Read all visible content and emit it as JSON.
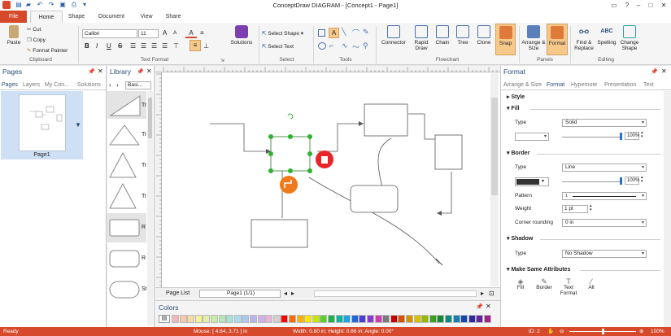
{
  "window": {
    "title": "ConceptDraw DIAGRAM - [Concept1 - Page1]"
  },
  "tabs": {
    "file": "File",
    "items": [
      "Home",
      "Shape",
      "Document",
      "View",
      "Share"
    ]
  },
  "clipboard": {
    "paste": "Paste",
    "cut": "Cut",
    "copy": "Copy",
    "format_painter": "Format Painter",
    "group": "Clipboard"
  },
  "text_format": {
    "font": "Calibri",
    "size": "11",
    "group": "Text Format",
    "bold": "B",
    "italic": "I",
    "underline": "U",
    "strike": "S",
    "grow": "A",
    "shrink": "A"
  },
  "solutions": {
    "label": "Solutions"
  },
  "select": {
    "select_shape": "Select Shape",
    "select_text": "Select Text",
    "group": "Select"
  },
  "tools": {
    "group": "Tools"
  },
  "flowchart": {
    "connector": "Connector",
    "rapid_draw": "Rapid Draw",
    "chain": "Chain",
    "tree": "Tree",
    "clone": "Clone",
    "snap": "Snap",
    "group": "Flowchart"
  },
  "panels": {
    "arrange": "Arrange & Size",
    "format": "Format",
    "group": "Panels"
  },
  "editing": {
    "find": "Find & Replace",
    "spelling": "Spelling",
    "change_shape": "Change Shape",
    "group": "Editing"
  },
  "pages_panel": {
    "title": "Pages",
    "tabs": [
      "Pages",
      "Layers",
      "My Con...",
      "Solutions"
    ],
    "page_label": "Page1"
  },
  "library": {
    "title": "Library",
    "combo": "Basi...",
    "items": [
      "Tr",
      "Tr",
      "Tr",
      "Tr",
      "R",
      "R",
      "St"
    ]
  },
  "canvas": {
    "page_list": "Page List",
    "page_combo": "Page1 (1/1)"
  },
  "colors_panel": {
    "title": "Colors",
    "swatches": [
      "#f3b8b8",
      "#f6c7a8",
      "#f6dca0",
      "#f6ef9c",
      "#e2f0a0",
      "#c9eba4",
      "#b2e6b6",
      "#a6e2d6",
      "#a8dcef",
      "#a8c8f0",
      "#b6b6ef",
      "#cfb0ec",
      "#eeb0dc",
      "#d0d0d0",
      "#ff0000",
      "#ff6a00",
      "#ffb000",
      "#ffe600",
      "#c8e600",
      "#5ccf2a",
      "#1fb24a",
      "#12b2a0",
      "#1da6e0",
      "#2266d8",
      "#4a3fd0",
      "#8a3bd0",
      "#d03bb4",
      "#7a7a7a",
      "#c40000",
      "#d85000",
      "#d89000",
      "#d8c200",
      "#96b800",
      "#3aa01a",
      "#0f8a36",
      "#0a8a7c",
      "#1080b0",
      "#1446a8",
      "#302aa0",
      "#6424a0",
      "#a02486"
    ]
  },
  "format_panel": {
    "title": "Format",
    "tabs": [
      "Arrange & Size",
      "Format",
      "Hypernote",
      "Presentation",
      "Text"
    ],
    "style": "Style",
    "fill": "Fill",
    "type_label": "Type",
    "fill_type": "Solid",
    "fill_pct": "100%",
    "border": "Border",
    "border_type": "Line",
    "border_pct": "100%",
    "pattern_label": "Pattern",
    "pattern_val": "1",
    "weight_label": "Weight",
    "weight": "1 pt",
    "corner_label": "Corner rounding",
    "corner": "0 in",
    "shadow": "Shadow",
    "shadow_type": "No Shadow",
    "make_same": "Make Same Attributes",
    "same_items": [
      "Fill",
      "Border",
      "Text Format",
      "All"
    ]
  },
  "status": {
    "ready": "Ready",
    "mouse": "Mouse: [ 4.64, 3.71 ] in",
    "size": "Width: 0.80 in; Height: 0.66 in; Angle: 0.00°",
    "id": "ID: 2",
    "zoom": "100%"
  },
  "colors": {
    "accent": "#d64a2b",
    "selection": "#2db32d",
    "delete": "#e8262a",
    "action": "#f07a1a"
  }
}
